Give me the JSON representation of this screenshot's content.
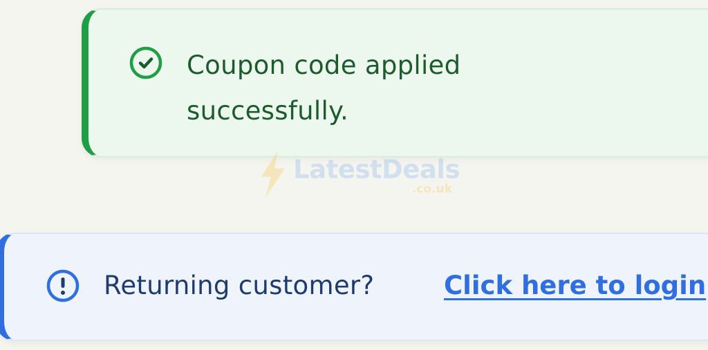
{
  "success_notice": {
    "icon": "check-circle-icon",
    "message": "Coupon code applied successfully.",
    "accent_color": "#1f9d47"
  },
  "info_notice": {
    "icon": "exclamation-circle-icon",
    "prompt": "Returning customer?",
    "link_label": "Click here to login",
    "accent_color": "#2f6fe0"
  },
  "watermark": {
    "icon": "lightning-bolt-icon",
    "brand": "LatestDeals",
    "tld": ".co.uk"
  }
}
